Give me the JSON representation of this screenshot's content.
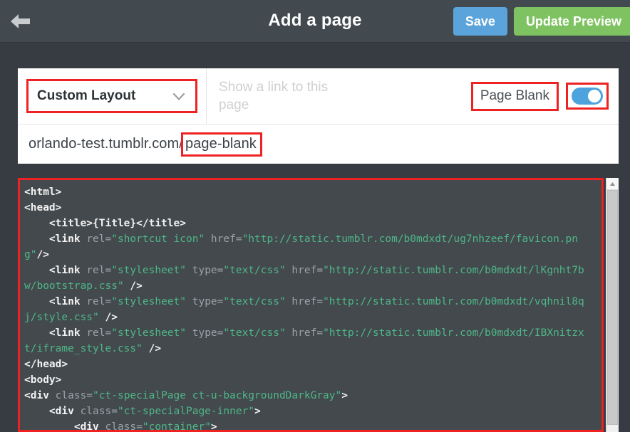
{
  "header": {
    "back_icon": "arrow-left-icon",
    "title": "Add a page",
    "save_label": "Save",
    "update_preview_label": "Update Preview"
  },
  "panel": {
    "layout_select": {
      "value": "Custom Layout",
      "chevron_icon": "chevron-down-icon"
    },
    "show_link_placeholder": "Show a link to this page",
    "page_blank_label": "Page Blank",
    "toggle": {
      "state": "on",
      "color": "#4da3dd"
    },
    "url": {
      "base": "orlando-test.tumblr.com/",
      "slug": "page-blank"
    }
  },
  "editor": {
    "scrollbar": {
      "up_arrow_icon": "triangle-up-icon"
    },
    "code_lines": [
      [
        {
          "t": "tg",
          "s": "<html>"
        }
      ],
      [
        {
          "t": "tg",
          "s": "<head>"
        }
      ],
      [
        {
          "t": "pl",
          "s": "    "
        },
        {
          "t": "tg",
          "s": "<title>{Title}</title>"
        }
      ],
      [
        {
          "t": "pl",
          "s": "    "
        },
        {
          "t": "tg",
          "s": "<link "
        },
        {
          "t": "at",
          "s": "rel="
        },
        {
          "t": "vl",
          "s": "\"shortcut icon\" "
        },
        {
          "t": "at",
          "s": "href="
        },
        {
          "t": "vl",
          "s": "\"http://static.tumblr.com/b0mdxdt/ug7nhzeef/favicon.png\""
        },
        {
          "t": "tg",
          "s": "/>"
        }
      ],
      [
        {
          "t": "pl",
          "s": "    "
        },
        {
          "t": "tg",
          "s": "<link "
        },
        {
          "t": "at",
          "s": "rel="
        },
        {
          "t": "vl",
          "s": "\"stylesheet\" "
        },
        {
          "t": "at",
          "s": "type="
        },
        {
          "t": "vl",
          "s": "\"text/css\" "
        },
        {
          "t": "at",
          "s": "href="
        },
        {
          "t": "vl",
          "s": "\"http://static.tumblr.com/b0mdxdt/lKgnht7bw/bootstrap.css\" "
        },
        {
          "t": "tg",
          "s": "/>"
        }
      ],
      [
        {
          "t": "pl",
          "s": "    "
        },
        {
          "t": "tg",
          "s": "<link "
        },
        {
          "t": "at",
          "s": "rel="
        },
        {
          "t": "vl",
          "s": "\"stylesheet\" "
        },
        {
          "t": "at",
          "s": "type="
        },
        {
          "t": "vl",
          "s": "\"text/css\" "
        },
        {
          "t": "at",
          "s": "href="
        },
        {
          "t": "vl",
          "s": "\"http://static.tumblr.com/b0mdxdt/vqhnil8qj/style.css\" "
        },
        {
          "t": "tg",
          "s": "/>"
        }
      ],
      [
        {
          "t": "pl",
          "s": "    "
        },
        {
          "t": "tg",
          "s": "<link "
        },
        {
          "t": "at",
          "s": "rel="
        },
        {
          "t": "vl",
          "s": "\"stylesheet\" "
        },
        {
          "t": "at",
          "s": "type="
        },
        {
          "t": "vl",
          "s": "\"text/css\" "
        },
        {
          "t": "at",
          "s": "href="
        },
        {
          "t": "vl",
          "s": "\"http://static.tumblr.com/b0mdxdt/IBXnitzxt/iframe_style.css\" "
        },
        {
          "t": "tg",
          "s": "/>"
        }
      ],
      [
        {
          "t": "tg",
          "s": "</head>"
        }
      ],
      [
        {
          "t": "tg",
          "s": "<body>"
        }
      ],
      [
        {
          "t": "tg",
          "s": "<div "
        },
        {
          "t": "at",
          "s": "class="
        },
        {
          "t": "vl",
          "s": "\"ct-specialPage ct-u-backgroundDarkGray\""
        },
        {
          "t": "tg",
          "s": ">"
        }
      ],
      [
        {
          "t": "pl",
          "s": "    "
        },
        {
          "t": "tg",
          "s": "<div "
        },
        {
          "t": "at",
          "s": "class="
        },
        {
          "t": "vl",
          "s": "\"ct-specialPage-inner\""
        },
        {
          "t": "tg",
          "s": ">"
        }
      ],
      [
        {
          "t": "pl",
          "s": "        "
        },
        {
          "t": "tg",
          "s": "<div "
        },
        {
          "t": "at",
          "s": "class="
        },
        {
          "t": "vl",
          "s": "\"container\""
        },
        {
          "t": "tg",
          "s": ">"
        }
      ]
    ]
  }
}
